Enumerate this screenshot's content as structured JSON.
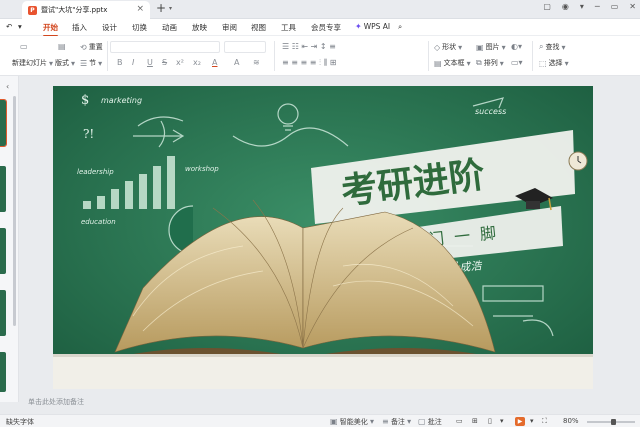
{
  "titlebar": {
    "doc_title": "暨试\"大坑\"分享.pptx",
    "file_badge": "P",
    "new_tab": "+",
    "new_tab_caret": "▾",
    "close": "×",
    "window_controls": [
      "▢",
      "◉",
      "▾",
      "─",
      "▭",
      "✕"
    ]
  },
  "menu": {
    "items": [
      "开始",
      "插入",
      "设计",
      "切换",
      "动画",
      "放映",
      "审阅",
      "视图",
      "工具",
      "会员专享"
    ],
    "active": "开始",
    "ai_label": "WPS AI",
    "ai_glyph": "✦",
    "search_glyph": "⌕",
    "undo_glyph": "↶",
    "caret": "▾"
  },
  "toolbar": {
    "new_slide": "新建幻灯片",
    "layout": "版式",
    "reset": "重置",
    "section": "节",
    "shape": "形状",
    "image": "图片",
    "textbox": "文本框",
    "arrange": "排列",
    "find": "查找",
    "select": "选择",
    "format_glyphs": [
      "B",
      "I",
      "U",
      "S",
      "x²",
      "x₂",
      "A",
      "A",
      "≋"
    ]
  },
  "slide": {
    "title": "考研进阶",
    "subtitle": "临门一脚",
    "presenter": "分享人：叶成浩",
    "chalk_words": [
      "marketing",
      "leadership",
      "workshop",
      "education",
      "success"
    ]
  },
  "notes_placeholder": "单击此处添加备注",
  "status": {
    "missing_font": "缺失字体",
    "smart_beautify": "智能美化",
    "notes": "备注",
    "comments": "批注",
    "zoom": "80%",
    "zoom_fraction": 0.55
  },
  "colors": {
    "accent": "#d2471f",
    "chalkboard": "#2c7a55",
    "banner_text": "#2f6b3c"
  }
}
